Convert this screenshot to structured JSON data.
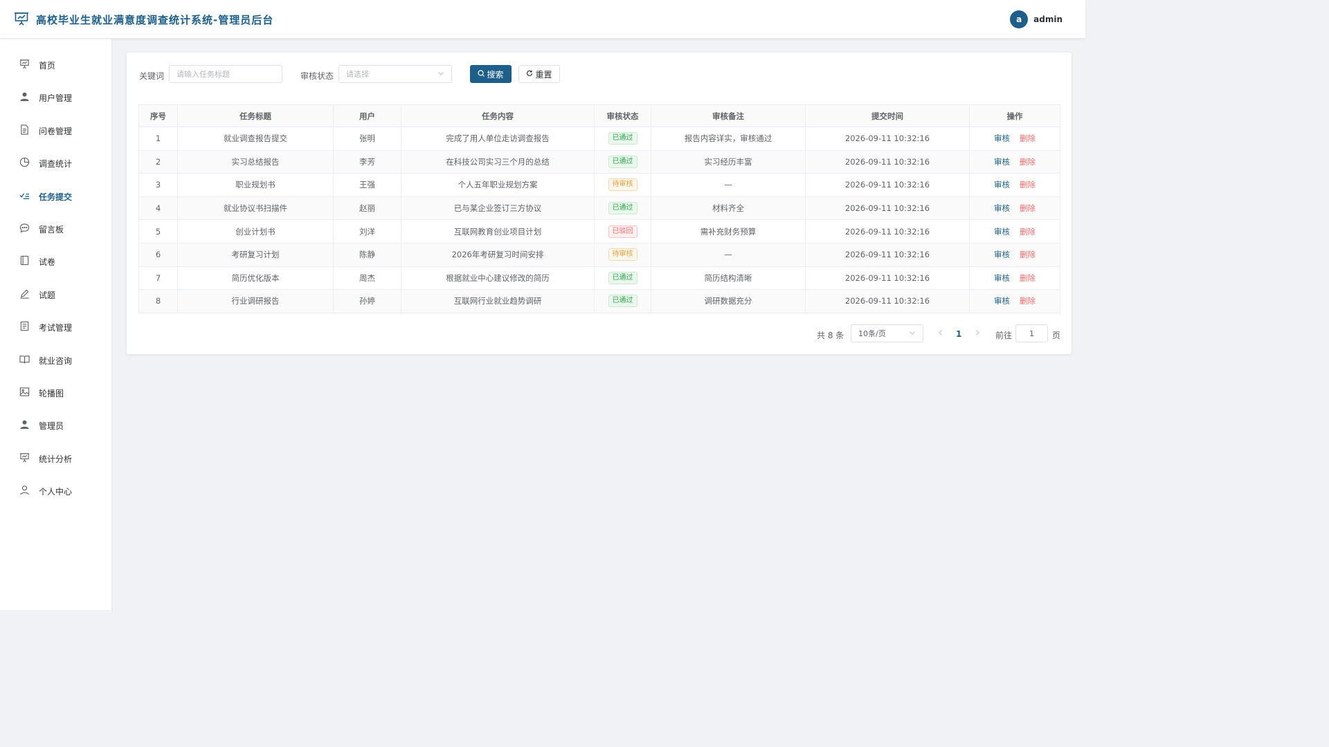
{
  "header": {
    "title": "高校毕业生就业满意度调查统计系统-管理员后台",
    "avatar_letter": "a",
    "username": "admin"
  },
  "sidebar": {
    "items": [
      {
        "label": "首页",
        "icon": "presentation-icon"
      },
      {
        "label": "用户管理",
        "icon": "user-icon"
      },
      {
        "label": "问卷管理",
        "icon": "document-icon"
      },
      {
        "label": "调查统计",
        "icon": "pie-chart-icon"
      },
      {
        "label": "任务提交",
        "icon": "check-list-icon"
      },
      {
        "label": "留言板",
        "icon": "chat-icon"
      },
      {
        "label": "试卷",
        "icon": "notebook-icon"
      },
      {
        "label": "试题",
        "icon": "pen-icon"
      },
      {
        "label": "考试管理",
        "icon": "list-document-icon"
      },
      {
        "label": "就业咨询",
        "icon": "book-icon"
      },
      {
        "label": "轮播图",
        "icon": "image-icon"
      },
      {
        "label": "管理员",
        "icon": "user-icon"
      },
      {
        "label": "统计分析",
        "icon": "presentation-icon"
      },
      {
        "label": "个人中心",
        "icon": "user-outline-icon"
      }
    ],
    "active_index": 4
  },
  "filters": {
    "keyword_label": "关键词",
    "keyword_placeholder": "请输入任务标题",
    "status_label": "审核状态",
    "status_placeholder": "请选择",
    "search_label": "搜索",
    "reset_label": "重置"
  },
  "table": {
    "columns": [
      "序号",
      "任务标题",
      "用户",
      "任务内容",
      "审核状态",
      "审核备注",
      "提交时间",
      "操作"
    ],
    "rows": [
      {
        "no": "1",
        "title": "就业调查报告提交",
        "user": "张明",
        "content": "完成了用人单位走访调查报告",
        "status": "已通过",
        "status_type": "ok",
        "remark": "报告内容详实，审核通过",
        "time": "2026-09-11 10:32:16"
      },
      {
        "no": "2",
        "title": "实习总结报告",
        "user": "李芳",
        "content": "在科技公司实习三个月的总结",
        "status": "已通过",
        "status_type": "ok",
        "remark": "实习经历丰富",
        "time": "2026-09-11 10:32:16"
      },
      {
        "no": "3",
        "title": "职业规划书",
        "user": "王强",
        "content": "个人五年职业规划方案",
        "status": "待审核",
        "status_type": "pending",
        "remark": "—",
        "time": "2026-09-11 10:32:16"
      },
      {
        "no": "4",
        "title": "就业协议书扫描件",
        "user": "赵丽",
        "content": "已与某企业签订三方协议",
        "status": "已通过",
        "status_type": "ok",
        "remark": "材料齐全",
        "time": "2026-09-11 10:32:16"
      },
      {
        "no": "5",
        "title": "创业计划书",
        "user": "刘洋",
        "content": "互联网教育创业项目计划",
        "status": "已驳回",
        "status_type": "reject",
        "remark": "需补充财务预算",
        "time": "2026-09-11 10:32:16"
      },
      {
        "no": "6",
        "title": "考研复习计划",
        "user": "陈静",
        "content": "2026年考研复习时间安排",
        "status": "待审核",
        "status_type": "pending",
        "remark": "—",
        "time": "2026-09-11 10:32:16"
      },
      {
        "no": "7",
        "title": "简历优化版本",
        "user": "周杰",
        "content": "根据就业中心建议修改的简历",
        "status": "已通过",
        "status_type": "ok",
        "remark": "简历结构清晰",
        "time": "2026-09-11 10:32:16"
      },
      {
        "no": "8",
        "title": "行业调研报告",
        "user": "孙婷",
        "content": "互联网行业就业趋势调研",
        "status": "已通过",
        "status_type": "ok",
        "remark": "调研数据充分",
        "time": "2026-09-11 10:32:16"
      }
    ],
    "action_review": "审核",
    "action_delete": "删除"
  },
  "pagination": {
    "total_text": "共 8 条",
    "page_size": "10条/页",
    "current_page": "1",
    "goto_label": "前往",
    "goto_value": "1",
    "page_suffix": "页"
  },
  "colors": {
    "primary": "#1d5f8a",
    "approved": "#2ea24a",
    "pending": "#e6a23c",
    "rejected": "#f56c6c"
  }
}
